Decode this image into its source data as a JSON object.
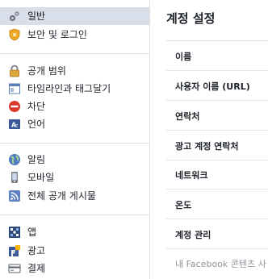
{
  "sidebar": {
    "groups": [
      {
        "items": [
          {
            "label": "일반",
            "icon": "gear-icon",
            "active": true
          },
          {
            "label": "보안 및 로그인",
            "icon": "shield-icon",
            "active": false
          }
        ]
      },
      {
        "items": [
          {
            "label": "공개 범위",
            "icon": "lock-icon",
            "active": false
          },
          {
            "label": "타임라인과 태그달기",
            "icon": "timeline-icon",
            "active": false
          },
          {
            "label": "차단",
            "icon": "block-icon",
            "active": false
          },
          {
            "label": "언어",
            "icon": "language-icon",
            "active": false
          }
        ]
      },
      {
        "items": [
          {
            "label": "알림",
            "icon": "globe-icon",
            "active": false
          },
          {
            "label": "모바일",
            "icon": "mobile-icon",
            "active": false
          },
          {
            "label": "전체 공개 게시물",
            "icon": "rss-icon",
            "active": false
          }
        ]
      },
      {
        "items": [
          {
            "label": "앱",
            "icon": "apps-icon",
            "active": false
          },
          {
            "label": "광고",
            "icon": "ads-icon",
            "active": false
          },
          {
            "label": "결제",
            "icon": "payment-card-icon",
            "active": false
          }
        ]
      }
    ]
  },
  "main": {
    "title": "계정 설정",
    "rows": [
      {
        "label": "이름"
      },
      {
        "label": "사용자 이름 (URL)"
      },
      {
        "label": "연락처"
      },
      {
        "label": "광고 계정 연락처"
      },
      {
        "label": "네트워크"
      },
      {
        "label": "온도"
      },
      {
        "label": "계정 관리"
      }
    ],
    "footer_text": "내 Facebook 콘텐츠 사"
  },
  "colors": {
    "active_bg": "#d8dfea",
    "separator": "#dddfe2",
    "text": "#1d2129",
    "muted": "#90949c"
  }
}
